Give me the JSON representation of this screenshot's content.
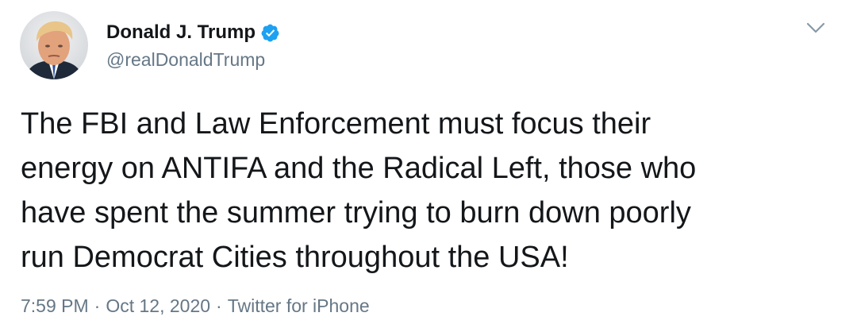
{
  "author": {
    "display_name": "Donald J. Trump",
    "handle": "@realDonaldTrump",
    "verified": true,
    "avatar_icon": "profile-photo"
  },
  "tweet": {
    "text": "The FBI and Law Enforcement must focus their\nenergy on ANTIFA and the Radical Left, those who\nhave spent the summer trying to burn down poorly\nrun Democrat Cities throughout the USA!",
    "time": "7:59 PM",
    "date": "Oct 12, 2020",
    "source": "Twitter for iPhone",
    "separator": "·"
  },
  "colors": {
    "verified_badge": "#1da1f2",
    "secondary_text": "#657786",
    "primary_text": "#14171a"
  }
}
